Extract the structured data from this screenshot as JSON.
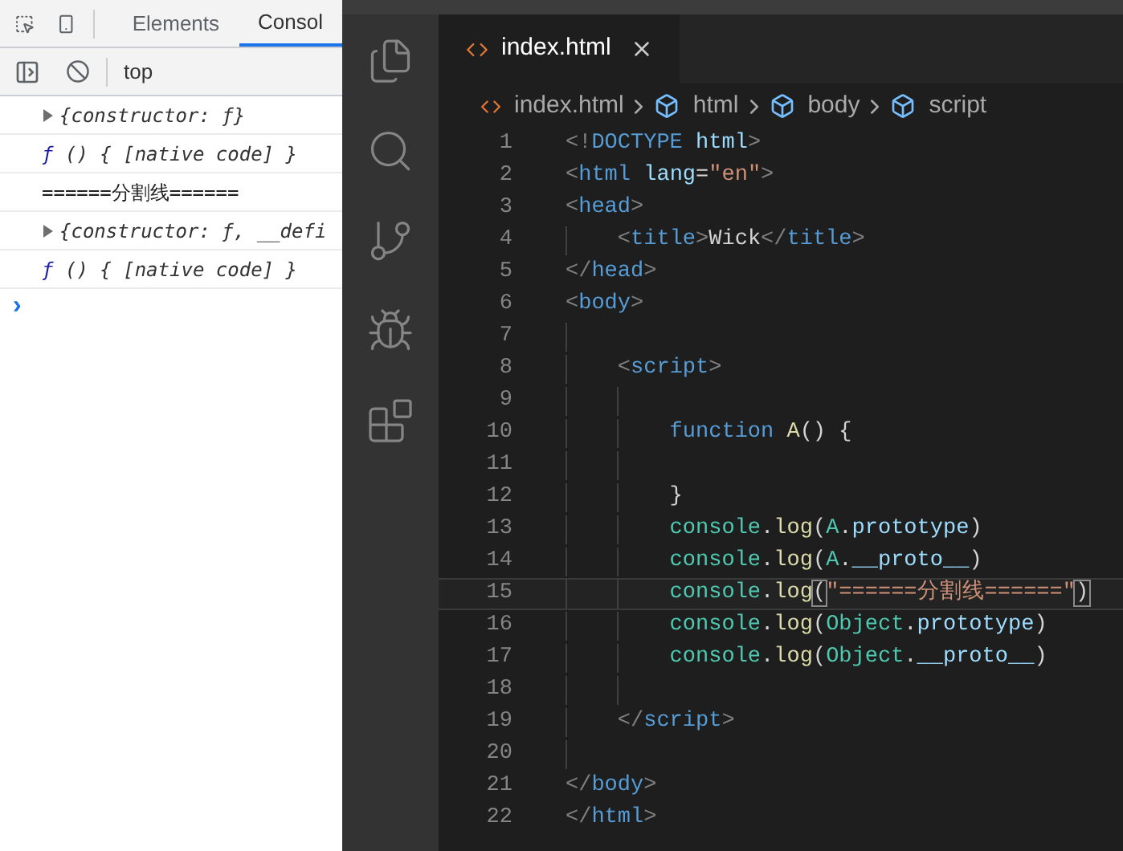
{
  "devtools": {
    "tabs": [
      {
        "label": "Elements",
        "selected": false
      },
      {
        "label": "Consol",
        "selected": true
      }
    ],
    "context": "top",
    "console": [
      {
        "kind": "object",
        "text": "{constructor: ƒ}"
      },
      {
        "kind": "function",
        "prefix": "ƒ",
        "text": "() { [native code] }"
      },
      {
        "kind": "log",
        "text": "======分割线======"
      },
      {
        "kind": "object",
        "text": "{constructor: ƒ, __defi"
      },
      {
        "kind": "function",
        "prefix": "ƒ",
        "text": "() { [native code] }"
      }
    ],
    "prompt": "›"
  },
  "editor": {
    "tab": {
      "label": "index.html",
      "selected": true
    },
    "breadcrumb": [
      {
        "kind": "file",
        "label": "index.html"
      },
      {
        "kind": "element",
        "label": "html"
      },
      {
        "kind": "element",
        "label": "body"
      },
      {
        "kind": "element",
        "label": "script"
      }
    ],
    "lines": [
      {
        "number": "1",
        "current": false,
        "tokens": [
          {
            "kind": "punct",
            "text": "<!"
          },
          {
            "kind": "tag",
            "text": "DOCTYPE"
          },
          {
            "kind": "attr",
            "text": " html"
          },
          {
            "kind": "punct",
            "text": ">"
          }
        ]
      },
      {
        "number": "2",
        "current": false,
        "tokens": [
          {
            "kind": "punct",
            "text": "<"
          },
          {
            "kind": "tag",
            "text": "html"
          },
          {
            "kind": "attr",
            "text": " lang"
          },
          {
            "kind": "text",
            "text": "="
          },
          {
            "kind": "string",
            "text": "\"en\""
          },
          {
            "kind": "punct",
            "text": ">"
          }
        ]
      },
      {
        "number": "3",
        "current": false,
        "tokens": [
          {
            "kind": "punct",
            "text": "<"
          },
          {
            "kind": "tag",
            "text": "head"
          },
          {
            "kind": "punct",
            "text": ">"
          }
        ]
      },
      {
        "number": "4",
        "current": false,
        "tokens": [
          {
            "kind": "punct",
            "text": "    <"
          },
          {
            "kind": "tag",
            "text": "title"
          },
          {
            "kind": "punct",
            "text": ">"
          },
          {
            "kind": "text",
            "text": "Wick"
          },
          {
            "kind": "punct",
            "text": "</"
          },
          {
            "kind": "tag",
            "text": "title"
          },
          {
            "kind": "punct",
            "text": ">"
          }
        ]
      },
      {
        "number": "5",
        "current": false,
        "tokens": [
          {
            "kind": "punct",
            "text": "</"
          },
          {
            "kind": "tag",
            "text": "head"
          },
          {
            "kind": "punct",
            "text": ">"
          }
        ]
      },
      {
        "number": "6",
        "current": false,
        "tokens": [
          {
            "kind": "punct",
            "text": "<"
          },
          {
            "kind": "tag",
            "text": "body"
          },
          {
            "kind": "punct",
            "text": ">"
          }
        ]
      },
      {
        "number": "7",
        "current": false
      },
      {
        "number": "8",
        "current": false,
        "tokens": [
          {
            "kind": "punct",
            "text": "    <"
          },
          {
            "kind": "tag",
            "text": "script"
          },
          {
            "kind": "punct",
            "text": ">"
          }
        ]
      },
      {
        "number": "9",
        "current": false
      },
      {
        "number": "10",
        "current": false,
        "tokens": [
          {
            "kind": "keyword",
            "text": "        function"
          },
          {
            "kind": "func",
            "text": " A"
          },
          {
            "kind": "text",
            "text": "() {"
          }
        ]
      },
      {
        "number": "11",
        "current": false
      },
      {
        "number": "12",
        "current": false,
        "tokens": [
          {
            "kind": "text",
            "text": "        }"
          }
        ]
      },
      {
        "number": "13",
        "current": false,
        "tokens": [
          {
            "kind": "object",
            "text": "        console"
          },
          {
            "kind": "text",
            "text": "."
          },
          {
            "kind": "func",
            "text": "log"
          },
          {
            "kind": "text",
            "text": "("
          },
          {
            "kind": "object",
            "text": "A"
          },
          {
            "kind": "text",
            "text": "."
          },
          {
            "kind": "property",
            "text": "prototype"
          },
          {
            "kind": "text",
            "text": ")"
          }
        ]
      },
      {
        "number": "14",
        "current": false,
        "tokens": [
          {
            "kind": "object",
            "text": "        console"
          },
          {
            "kind": "text",
            "text": "."
          },
          {
            "kind": "func",
            "text": "log"
          },
          {
            "kind": "text",
            "text": "("
          },
          {
            "kind": "object",
            "text": "A"
          },
          {
            "kind": "text",
            "text": "."
          },
          {
            "kind": "property",
            "text": "__proto__"
          },
          {
            "kind": "text",
            "text": ")"
          }
        ]
      },
      {
        "number": "15",
        "current": true,
        "tokens": [
          {
            "kind": "object",
            "text": "        console"
          },
          {
            "kind": "text",
            "text": "."
          },
          {
            "kind": "func",
            "text": "log"
          },
          {
            "kind": "bracket",
            "text": "("
          },
          {
            "kind": "string",
            "text": "\"======分割线======\""
          },
          {
            "kind": "bracket",
            "text": ")"
          }
        ]
      },
      {
        "number": "16",
        "current": false,
        "tokens": [
          {
            "kind": "object",
            "text": "        console"
          },
          {
            "kind": "text",
            "text": "."
          },
          {
            "kind": "func",
            "text": "log"
          },
          {
            "kind": "text",
            "text": "("
          },
          {
            "kind": "object",
            "text": "Object"
          },
          {
            "kind": "text",
            "text": "."
          },
          {
            "kind": "property",
            "text": "prototype"
          },
          {
            "kind": "text",
            "text": ")"
          }
        ]
      },
      {
        "number": "17",
        "current": false,
        "tokens": [
          {
            "kind": "object",
            "text": "        console"
          },
          {
            "kind": "text",
            "text": "."
          },
          {
            "kind": "func",
            "text": "log"
          },
          {
            "kind": "text",
            "text": "("
          },
          {
            "kind": "object",
            "text": "Object"
          },
          {
            "kind": "text",
            "text": "."
          },
          {
            "kind": "property",
            "text": "__proto__"
          },
          {
            "kind": "text",
            "text": ")"
          }
        ]
      },
      {
        "number": "18",
        "current": false
      },
      {
        "number": "19",
        "current": false,
        "tokens": [
          {
            "kind": "punct",
            "text": "    </"
          },
          {
            "kind": "tag",
            "text": "script"
          },
          {
            "kind": "punct",
            "text": ">"
          }
        ]
      },
      {
        "number": "20",
        "current": false
      },
      {
        "number": "21",
        "current": false,
        "tokens": [
          {
            "kind": "punct",
            "text": "</"
          },
          {
            "kind": "tag",
            "text": "body"
          },
          {
            "kind": "punct",
            "text": ">"
          }
        ]
      },
      {
        "number": "22",
        "current": false,
        "tokens": [
          {
            "kind": "punct",
            "text": "</"
          },
          {
            "kind": "tag",
            "text": "html"
          },
          {
            "kind": "punct",
            "text": ">"
          }
        ]
      }
    ]
  }
}
